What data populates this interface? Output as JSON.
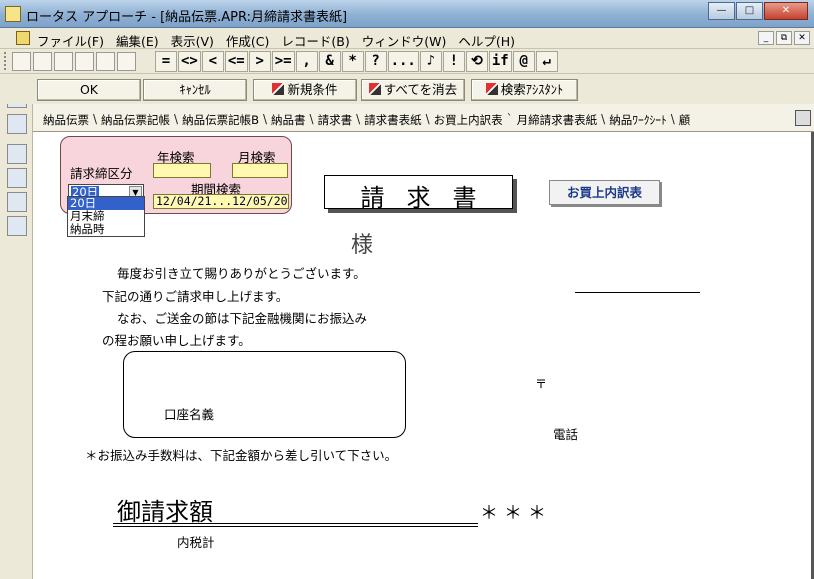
{
  "window": {
    "title": "ロータス アプローチ - [納品伝票.APR:月締請求書表紙]",
    "min_glyph": "—",
    "max_glyph": "□",
    "close_glyph": "✕"
  },
  "menu": {
    "items": [
      "ファイル(F)",
      "編集(E)",
      "表示(V)",
      "作成(C)",
      "レコード(B)",
      "ウィンドウ(W)",
      "ヘルプ(H)"
    ],
    "mdi": [
      "_",
      "⧉",
      "✕"
    ]
  },
  "toolbar": {
    "operators": [
      "=",
      "<>",
      "<",
      "<=",
      ">",
      ">=",
      ",",
      "&",
      "*",
      "?",
      "...",
      "!",
      "if",
      "@",
      "↵"
    ]
  },
  "buttons": {
    "ok": "OK",
    "cancel": "ｷｬﾝｾﾙ",
    "new_condition": "新規条件",
    "clear_all": "すべてを消去",
    "assistant": "検索ｱｼｽﾀﾝﾄ"
  },
  "tabs": [
    "納品伝票",
    "納品伝票記帳",
    "納品伝票記帳B",
    "納品書",
    "請求書",
    "請求書表紙",
    "お買上内訳表",
    "月締請求書表紙",
    "納品ﾜｰｸｼｰﾄ",
    "顧"
  ],
  "active_tab": "月締請求書表紙",
  "search_panel": {
    "closing_label": "請求締区分",
    "year_label": "年検索",
    "month_label": "月検索",
    "period_label": "期間検索",
    "period_value": "12/04/21...12/05/20",
    "selected_option": "20日",
    "options": [
      "20日",
      "月末締",
      "納品時"
    ]
  },
  "document": {
    "heading": "請求書",
    "breakdown_button": "お買上内訳表",
    "honorific": "様",
    "greeting_lines": [
      "毎度お引き立て賜りありがとうございます。",
      "下記の通りご請求申し上げます。",
      "なお、ご送金の節は下記金融機関にお振込み",
      "の程お願い申し上げます。"
    ],
    "account_name_label": "口座名義",
    "postal_mark": "〒",
    "phone_label": "電話",
    "fee_note": "＊お振込み手数料は、下記金額から差し引いて下さい。",
    "total_label": "御請求額",
    "total_value": "＊＊＊",
    "tax_label": "内税計"
  }
}
